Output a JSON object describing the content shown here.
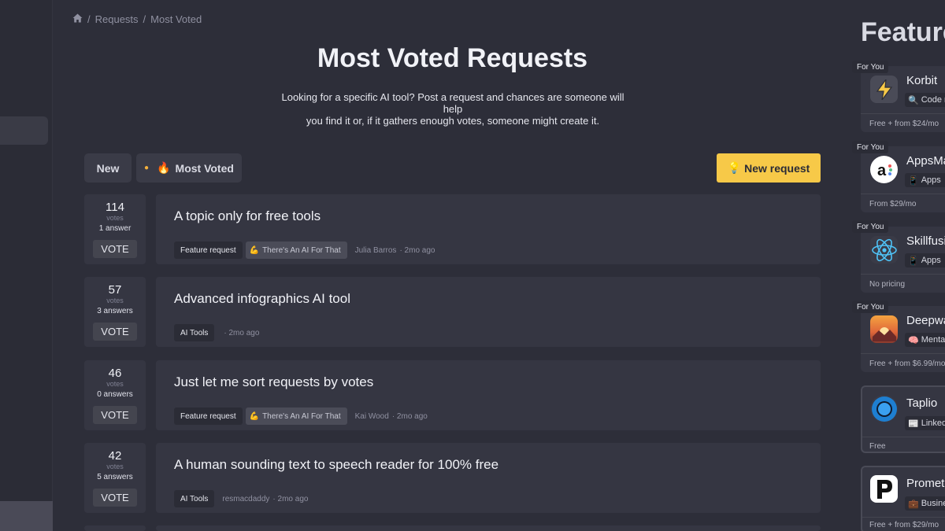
{
  "breadcrumb": {
    "home_icon": "home-icon",
    "items": [
      "Requests",
      "Most Voted"
    ]
  },
  "page": {
    "title": "Most Voted Requests",
    "description_line1": "Looking for a specific AI tool? Post a request and chances are someone will help",
    "description_line2": "you find it or, if it gathers enough votes, someone might create it."
  },
  "tabs": {
    "new": "New",
    "most_voted": "Most Voted",
    "most_voted_icon": "🔥",
    "active": "most_voted"
  },
  "new_request": {
    "label": "New request",
    "icon": "💡"
  },
  "vote_label": "votes",
  "vote_button": "VOTE",
  "requests": [
    {
      "votes": "114",
      "answers": "1 answer",
      "title": "A topic only for free tools",
      "tag": "Feature request",
      "app": "There's An AI For That",
      "app_icon": "💪",
      "author": "Julia Barros",
      "time": "· 2mo ago"
    },
    {
      "votes": "57",
      "answers": "3 answers",
      "title": "Advanced infographics AI tool",
      "tag": "AI Tools",
      "app": "",
      "author": "",
      "time": "· 2mo ago"
    },
    {
      "votes": "46",
      "answers": "0 answers",
      "title": "Just let me sort requests by votes",
      "tag": "Feature request",
      "app": "There's An AI For That",
      "app_icon": "💪",
      "author": "Kai Wood",
      "time": "· 2mo ago"
    },
    {
      "votes": "42",
      "answers": "5 answers",
      "title": "A human sounding text to speech reader for 100% free",
      "tag": "AI Tools",
      "app": "",
      "author": "resmacdaddy",
      "time": "· 2mo ago"
    }
  ],
  "featured": {
    "title": "Featured",
    "badge": "For You",
    "items": [
      {
        "name": "Korbit",
        "category": "Code r",
        "cat_icon": "🔍",
        "price": "Free + from $24/mo",
        "for_you": true
      },
      {
        "name": "AppsMa",
        "category": "Apps",
        "cat_icon": "📱",
        "price": "From $29/mo",
        "for_you": true
      },
      {
        "name": "Skillfusi",
        "category": "Apps",
        "cat_icon": "📱",
        "price": "No pricing",
        "for_you": true
      },
      {
        "name": "Deepwa",
        "category": "Menta",
        "cat_icon": "🧠",
        "price": "Free + from $6.99/mo",
        "for_you": true
      },
      {
        "name": "Taplio",
        "category": "Linked",
        "cat_icon": "📰",
        "price": "Free",
        "for_you": false
      },
      {
        "name": "Promet",
        "category": "Busine",
        "cat_icon": "💼",
        "price": "Free + from $29/mo",
        "for_you": false
      }
    ]
  },
  "colors": {
    "accent": "#f7c948",
    "background": "#2d2e39",
    "card": "#353642"
  }
}
